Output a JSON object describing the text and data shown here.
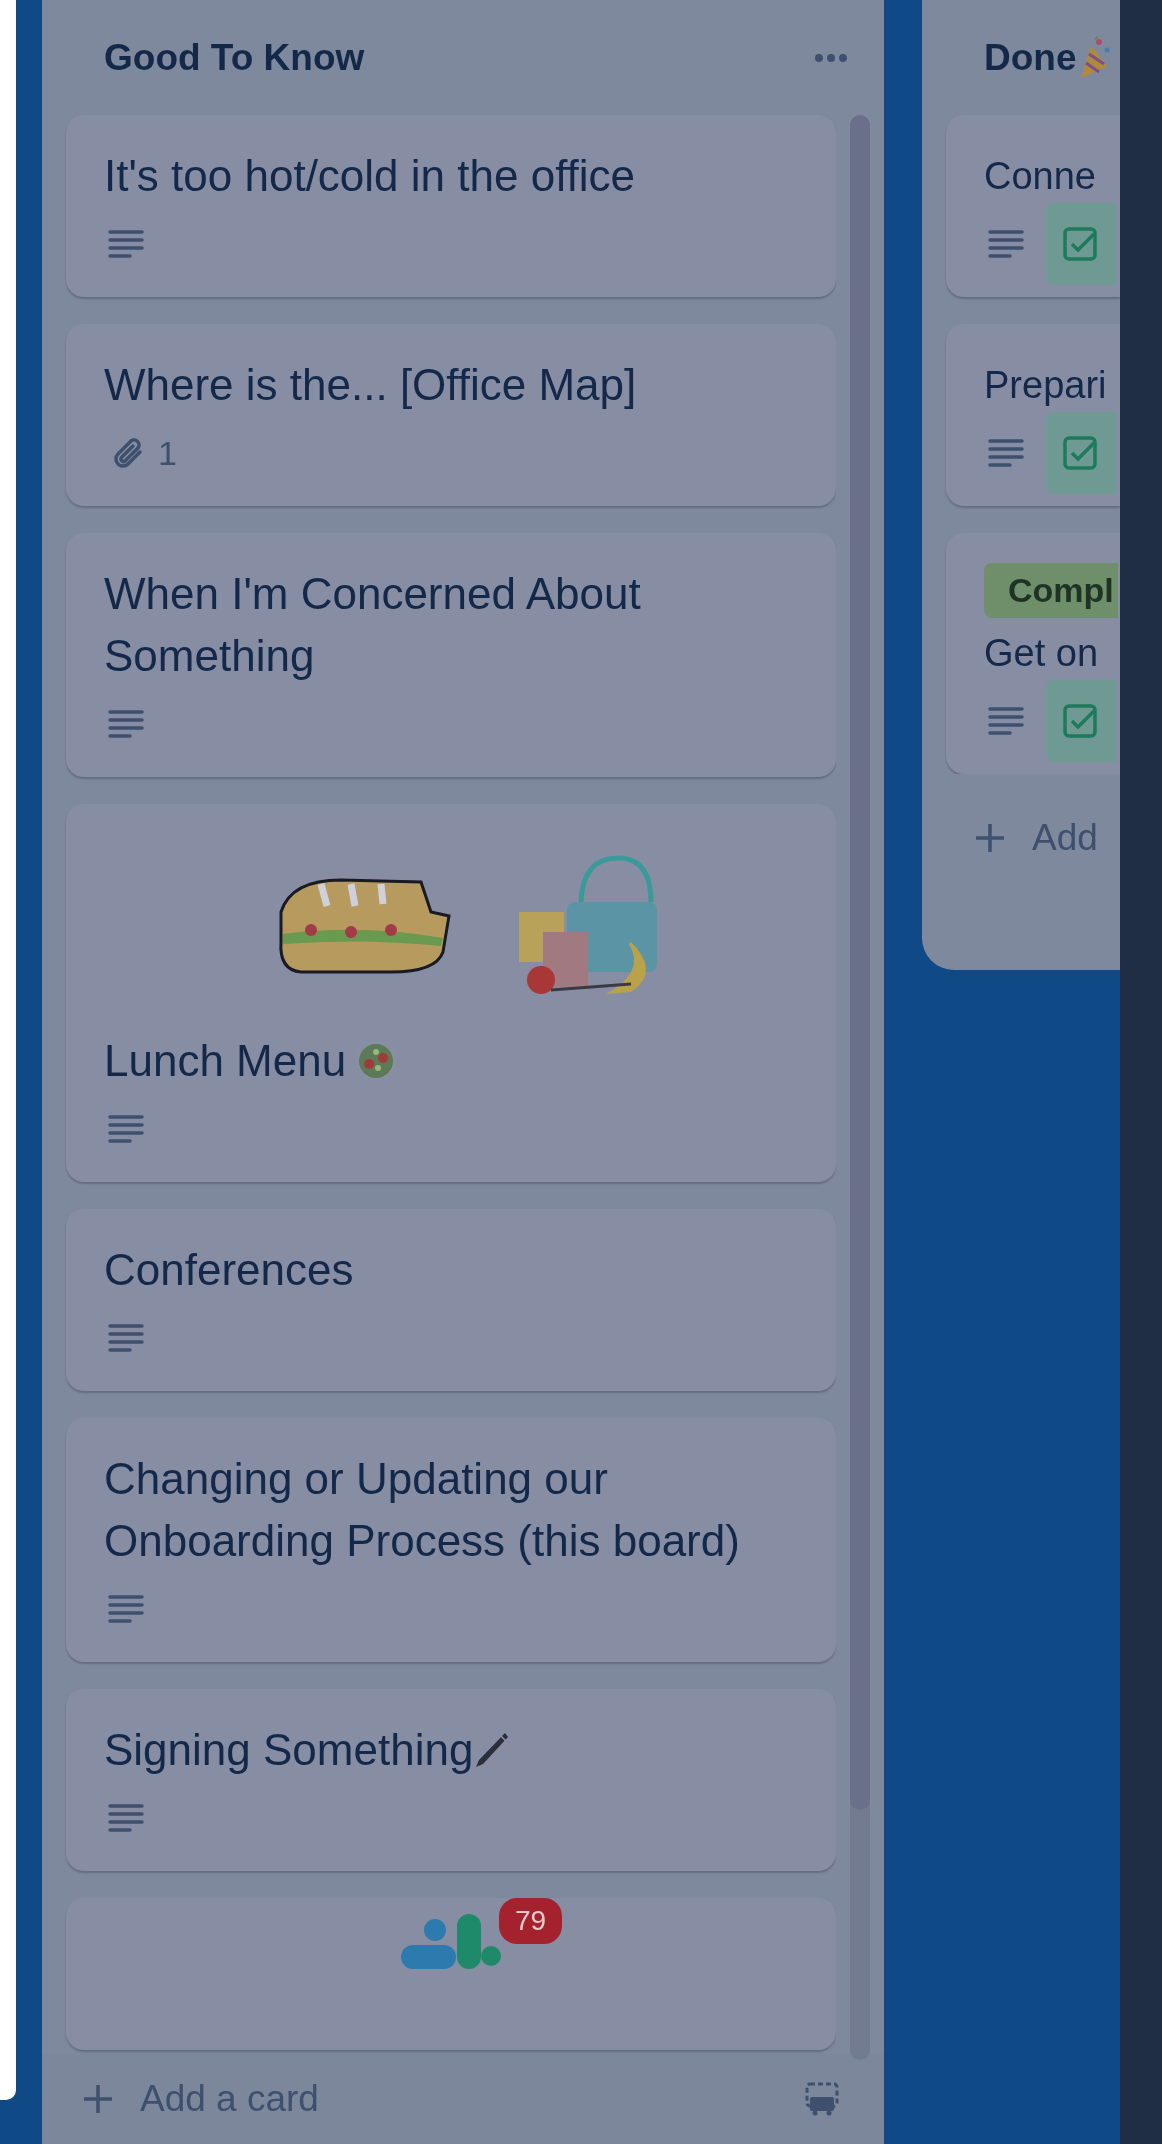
{
  "lists": [
    {
      "title": "Good To Know",
      "menu_button": true,
      "scrollbar": true,
      "add_card": "Add a card",
      "template_button": true,
      "cards": [
        {
          "title": "It's too hot/cold in the office",
          "badges": [
            {
              "kind": "description"
            }
          ]
        },
        {
          "title": "Where is the... [Office Map]",
          "badges": [
            {
              "kind": "attachments",
              "count": "1"
            }
          ]
        },
        {
          "title": "When I'm Concerned About Something",
          "badges": [
            {
              "kind": "description"
            }
          ]
        },
        {
          "cover": {
            "kind": "stickers"
          },
          "title": "Lunch Menu",
          "title_icon": {
            "kind": "salad"
          },
          "badges": [
            {
              "kind": "description"
            }
          ]
        },
        {
          "title": "Conferences",
          "badges": [
            {
              "kind": "description"
            }
          ]
        },
        {
          "title": "Changing or Updating our Onboarding Process (this board)",
          "badges": [
            {
              "kind": "description"
            }
          ]
        },
        {
          "title": "Signing Something",
          "title_icon": {
            "kind": "pen"
          },
          "badges": [
            {
              "kind": "description"
            }
          ]
        },
        {
          "cover": {
            "kind": "app-icon",
            "badge": "79"
          }
        }
      ]
    },
    {
      "title": "Done",
      "title_icon": {
        "kind": "party-popper"
      },
      "add_card": "Add",
      "cards": [
        {
          "title": "Conne",
          "badges": [
            {
              "kind": "description"
            },
            {
              "kind": "checklist"
            }
          ]
        },
        {
          "title": "Prepari",
          "badges": [
            {
              "kind": "description"
            },
            {
              "kind": "checklist"
            }
          ]
        },
        {
          "labels": [
            {
              "text": "Compl",
              "color": "#6f8f6a"
            }
          ],
          "title": "Get on",
          "badges": [
            {
              "kind": "description"
            },
            {
              "kind": "checklist"
            }
          ]
        }
      ]
    }
  ]
}
